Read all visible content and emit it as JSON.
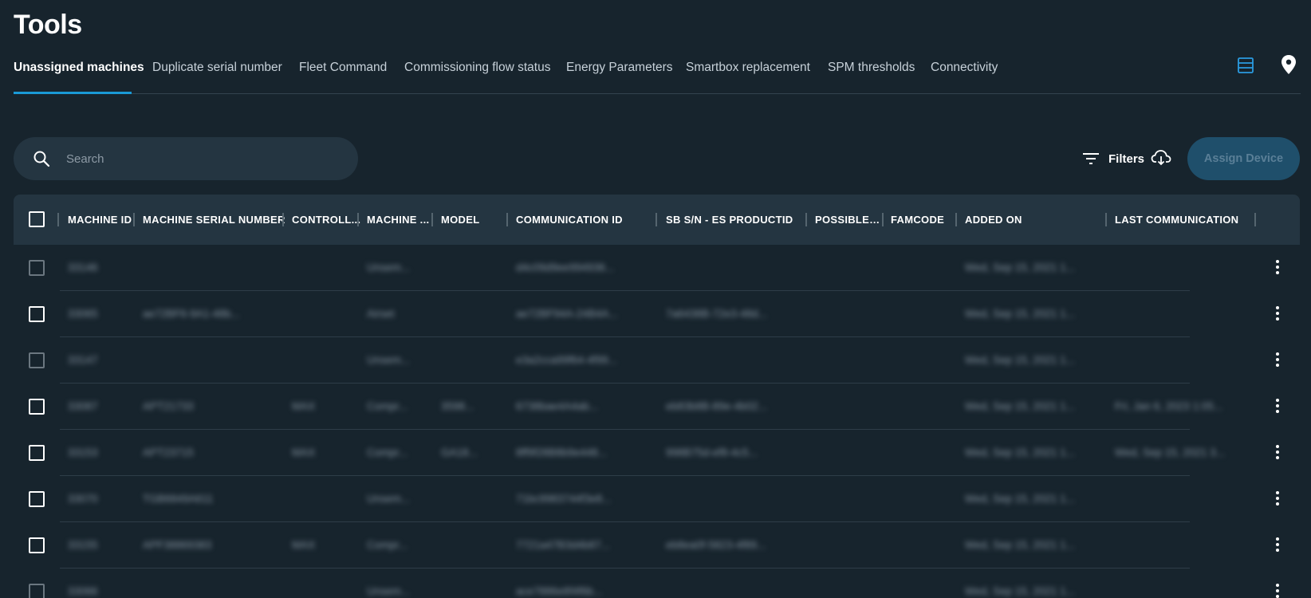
{
  "page": {
    "title": "Tools"
  },
  "tabs": [
    {
      "label": "Unassigned machines",
      "active": true
    },
    {
      "label": "Duplicate serial number",
      "active": false
    },
    {
      "label": "Fleet Command",
      "active": false
    },
    {
      "label": "Commissioning flow status",
      "active": false
    },
    {
      "label": "Energy Parameters",
      "active": false
    },
    {
      "label": "Smartbox replacement",
      "active": false
    },
    {
      "label": "SPM thresholds",
      "active": false
    },
    {
      "label": "Connectivity",
      "active": false
    }
  ],
  "header_icons": {
    "view": "list-view-icon",
    "map": "location-pin-icon"
  },
  "toolbar": {
    "search_placeholder": "Search",
    "search_value": "",
    "filters_label": "Filters",
    "download_icon": "cloud-download-icon",
    "assign_label": "Assign Device",
    "assign_enabled": false
  },
  "table": {
    "columns": [
      "MACHINE ID",
      "MACHINE SERIAL NUMBER",
      "CONTROLL...",
      "MACHINE ...",
      "MODEL",
      "COMMUNICATION ID",
      "SB S/N - ES PRODUCTID",
      "POSSIBLEL...",
      "FAMCODE",
      "ADDED ON",
      "LAST COMMUNICATION"
    ],
    "rows": [
      {
        "checkbox_enabled": false,
        "cells": [
          "33146",
          "",
          "",
          "Unsem...",
          "",
          "d4c09d9ee994936...",
          "",
          "",
          "",
          "Wed, Sep 15, 2021 1...",
          ""
        ]
      },
      {
        "checkbox_enabled": true,
        "cells": [
          "33065",
          "ae72BF6-9A1-48b...",
          "",
          "Airset",
          "",
          "ae72BF94A-24B4A...",
          "7a6438B-72e3-48d...",
          "",
          "",
          "Wed, Sep 15, 2021 1...",
          ""
        ]
      },
      {
        "checkbox_enabled": false,
        "cells": [
          "33147",
          "",
          "",
          "Unsem...",
          "",
          "e3a2cca99f64-4f99...",
          "",
          "",
          "",
          "Wed, Sep 15, 2021 1...",
          ""
        ]
      },
      {
        "checkbox_enabled": true,
        "cells": [
          "33087",
          "APT21733",
          "MAX",
          "Compr...",
          "3598...",
          "6738bae4A4ab...",
          "eb83b8B-89e-4b02...",
          "",
          "",
          "Wed, Sep 15, 2021 1...",
          "Fri, Jan 6, 2023 1:05..."
        ]
      },
      {
        "checkbox_enabled": true,
        "cells": [
          "33153",
          "APT23715",
          "MAX",
          "Compr...",
          "GA18...",
          "8ff9f28B8b9e448...",
          "998B75d-ef8-4c5...",
          "",
          "",
          "Wed, Sep 15, 2021 1...",
          "Wed, Sep 15, 2021 3..."
        ]
      },
      {
        "checkbox_enabled": true,
        "cells": [
          "33070",
          "TGB6849A611",
          "",
          "Unsem...",
          "",
          "71bc9983744f3e8...",
          "",
          "",
          "",
          "Wed, Sep 15, 2021 1...",
          ""
        ]
      },
      {
        "checkbox_enabled": true,
        "cells": [
          "33155",
          "APF38869383",
          "MAX",
          "Compr...",
          "",
          "7721a47B3d4b87...",
          "eb8ea0f-5823-4f89...",
          "",
          "",
          "Wed, Sep 15, 2021 1...",
          ""
        ]
      },
      {
        "checkbox_enabled": false,
        "cells": [
          "33066",
          "",
          "",
          "Unsem...",
          "",
          "ace7886e8f4f6b...",
          "",
          "",
          "",
          "Wed, Sep 15, 2021 1...",
          ""
        ]
      }
    ]
  }
}
